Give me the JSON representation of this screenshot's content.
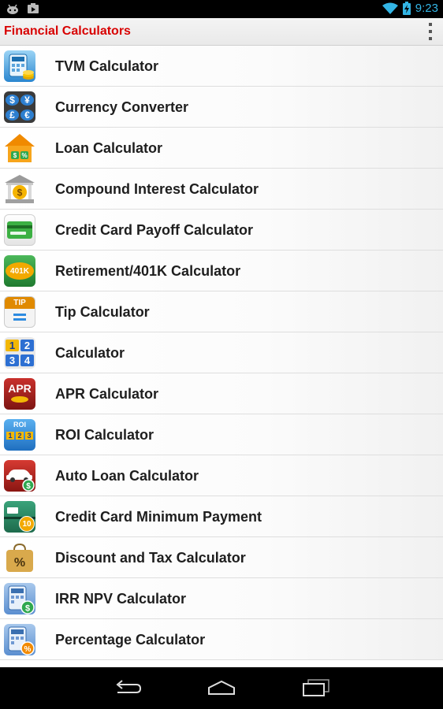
{
  "status": {
    "time": "9:23"
  },
  "app": {
    "title": "Financial Calculators"
  },
  "items": [
    {
      "label": "TVM Calculator"
    },
    {
      "label": "Currency Converter",
      "glyphs": [
        "$",
        "¥",
        "£",
        "€"
      ]
    },
    {
      "label": "Loan Calculator"
    },
    {
      "label": "Compound Interest Calculator"
    },
    {
      "label": "Credit Card Payoff Calculator"
    },
    {
      "label": "Retirement/401K Calculator",
      "icon_text": "401K"
    },
    {
      "label": "Tip Calculator",
      "icon_text": "TIP"
    },
    {
      "label": "Calculator",
      "digits": [
        "1",
        "2",
        "3",
        "4"
      ]
    },
    {
      "label": "APR Calculator",
      "icon_text": "APR"
    },
    {
      "label": "ROI Calculator",
      "icon_text": "ROI",
      "digits": [
        "1",
        "2",
        "3"
      ]
    },
    {
      "label": "Auto Loan Calculator"
    },
    {
      "label": "Credit Card Minimum Payment",
      "icon_text": "10"
    },
    {
      "label": "Discount and Tax Calculator"
    },
    {
      "label": "IRR NPV Calculator"
    },
    {
      "label": "Percentage Calculator"
    }
  ]
}
